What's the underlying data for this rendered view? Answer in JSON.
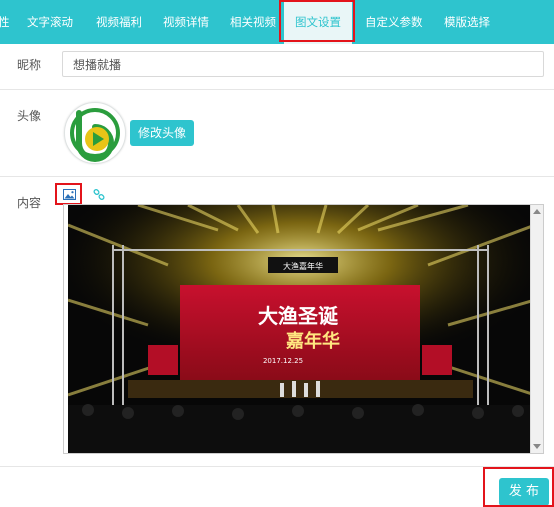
{
  "tabs": [
    {
      "label": "性"
    },
    {
      "label": "文字滚动"
    },
    {
      "label": "视频福利"
    },
    {
      "label": "视频详情"
    },
    {
      "label": "相关视频"
    },
    {
      "label": "图文设置",
      "active": true
    },
    {
      "label": "自定义参数"
    },
    {
      "label": "模版选择"
    }
  ],
  "form": {
    "nickname_label": "昵称",
    "nickname_value": "想播就播",
    "avatar_label": "头像",
    "change_avatar_button": "修改头像",
    "content_label": "内容",
    "publish_button": "发 布"
  },
  "editor_image": {
    "banner_line1": "大渔圣诞",
    "banner_line2": "嘉年华",
    "logo_text": "大渔嘉年华",
    "date_text": "2017.12.25"
  },
  "icons": [
    "image-icon",
    "link-icon",
    "avatar-logo-icon"
  ],
  "colors": {
    "accent": "#2ec4ce",
    "highlight": "#e3141b"
  }
}
